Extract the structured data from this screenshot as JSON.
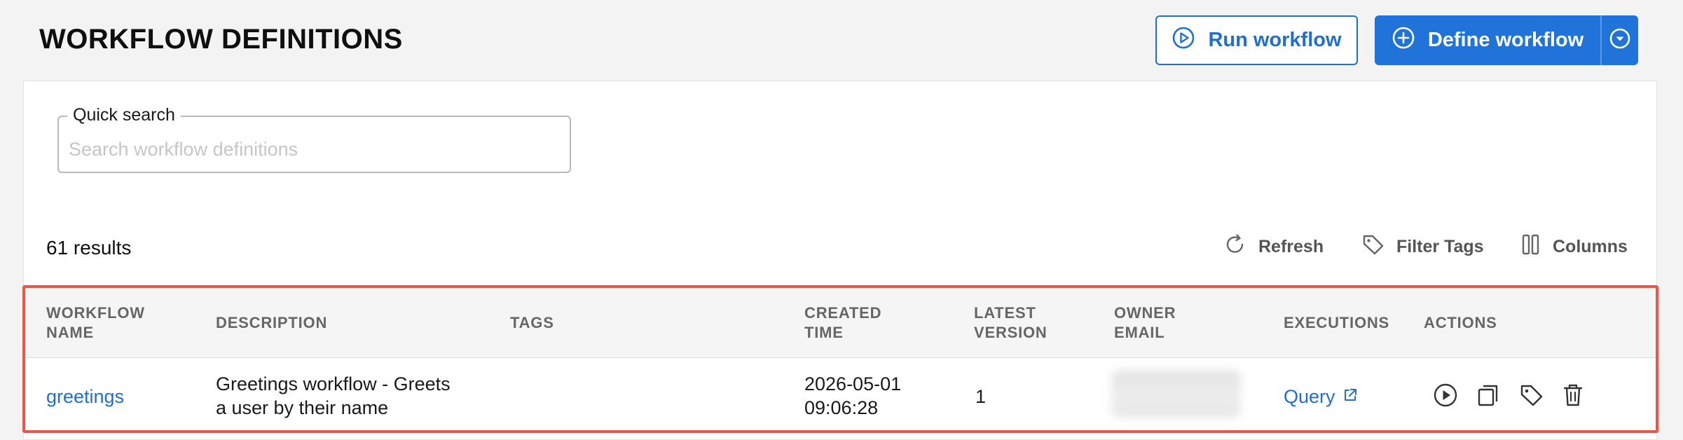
{
  "header": {
    "title": "WORKFLOW DEFINITIONS",
    "run_label": "Run workflow",
    "define_label": "Define workflow"
  },
  "search": {
    "label": "Quick search",
    "placeholder": "Search workflow definitions",
    "value": ""
  },
  "toolbar": {
    "results": "61 results",
    "refresh": "Refresh",
    "filter_tags": "Filter Tags",
    "columns": "Columns"
  },
  "table": {
    "headers": {
      "name_1": "WORKFLOW",
      "name_2": "NAME",
      "description": "DESCRIPTION",
      "tags": "TAGS",
      "created_1": "CREATED",
      "created_2": "TIME",
      "version_1": "LATEST",
      "version_2": "VERSION",
      "owner_1": "OWNER",
      "owner_2": "EMAIL",
      "executions": "EXECUTIONS",
      "actions": "ACTIONS"
    },
    "rows": [
      {
        "name": "greetings",
        "description_1": "Greetings workflow - Greets",
        "description_2": "a user by their name",
        "tags": "",
        "created_1": "2026-05-01",
        "created_2": "09:06:28",
        "version": "1",
        "executions": "Query"
      }
    ]
  },
  "colors": {
    "primary": "#1f73d9",
    "highlight_border": "#e8574a",
    "header_bg": "#f5f5f5"
  },
  "icons": [
    "play-circle-icon",
    "plus-circle-icon",
    "chevron-down-circle-icon",
    "refresh-icon",
    "tag-icon",
    "columns-icon",
    "external-link-icon",
    "copy-icon",
    "trash-icon"
  ]
}
